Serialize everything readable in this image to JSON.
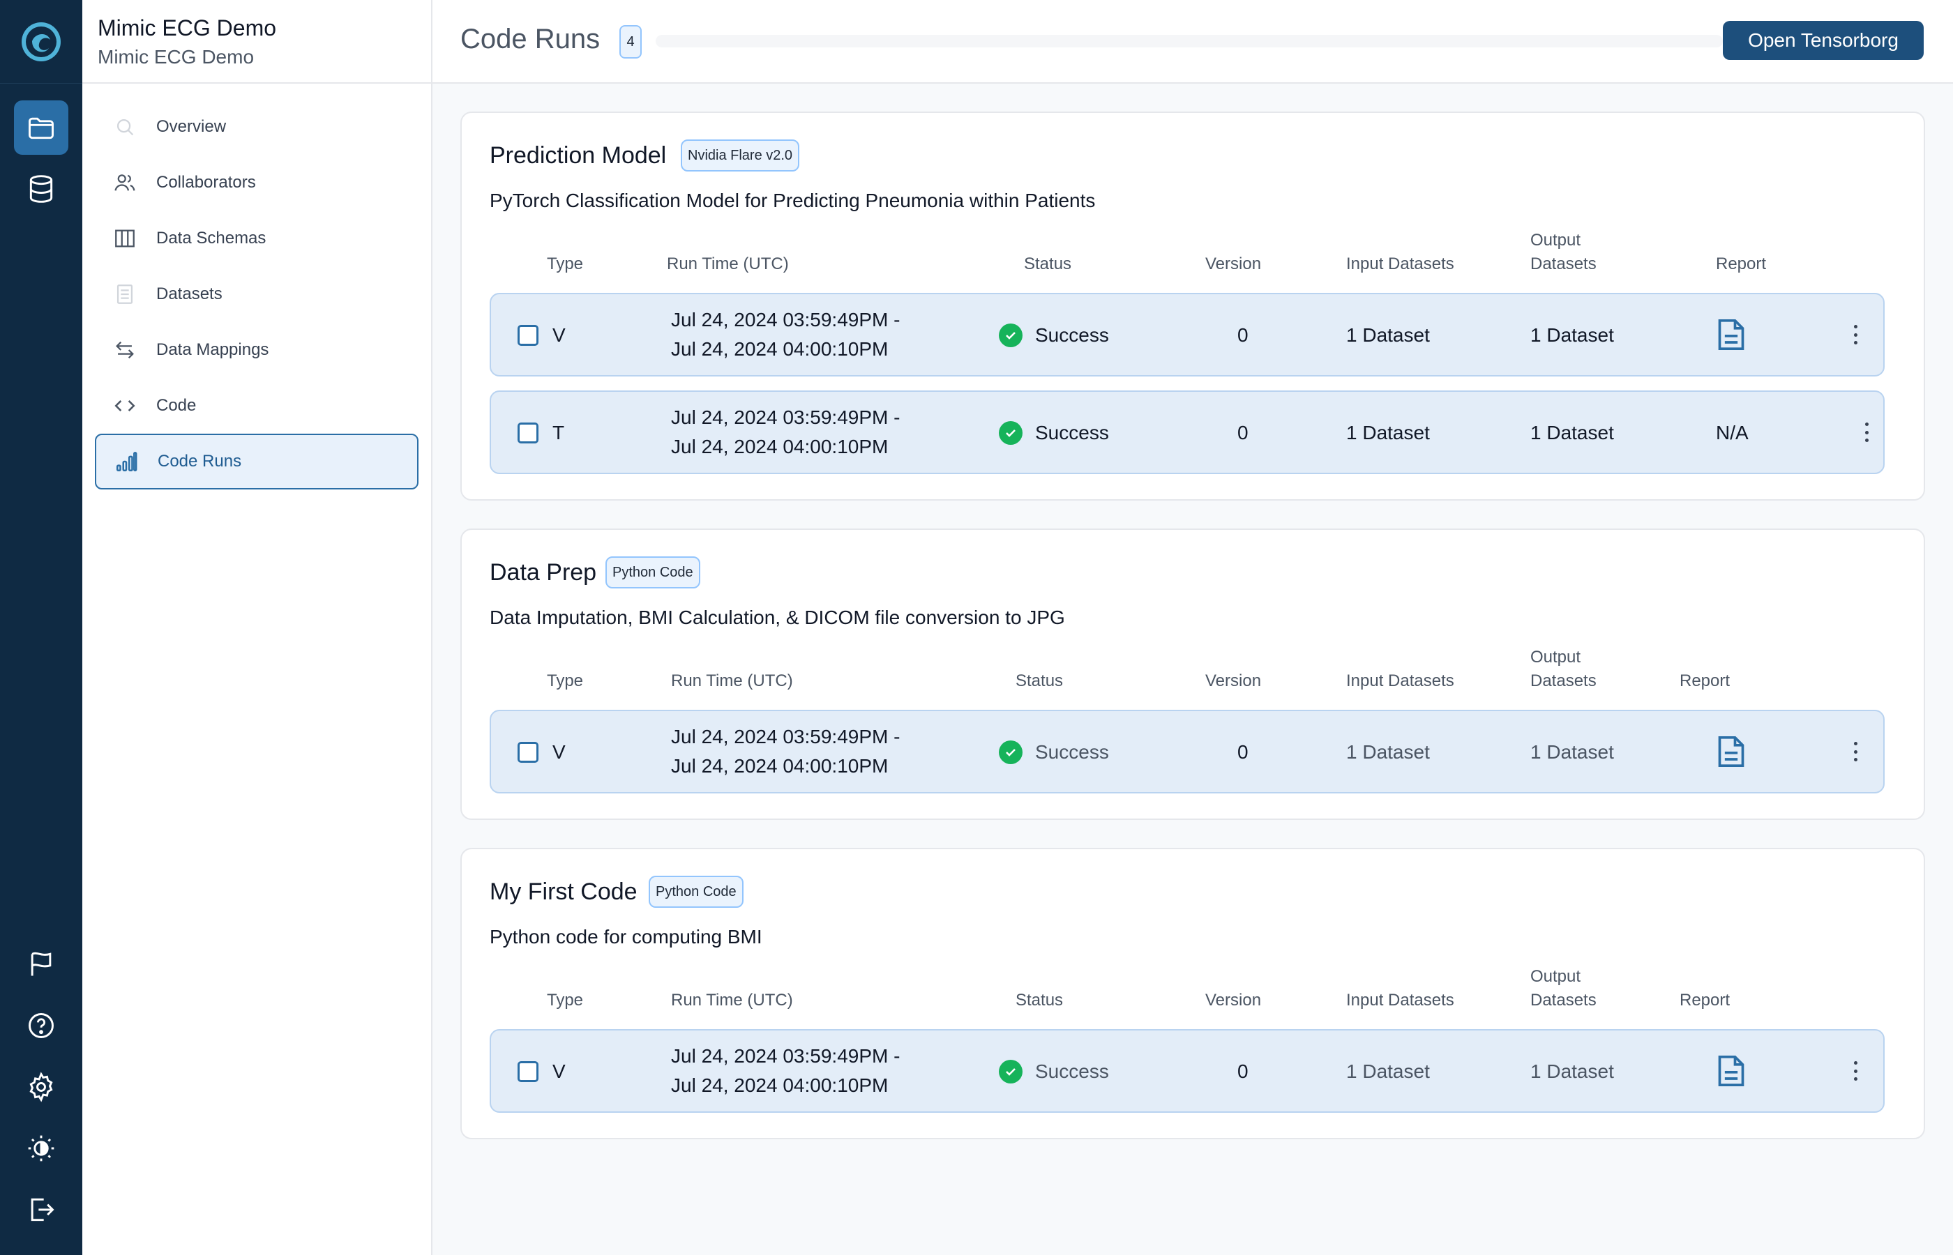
{
  "project": {
    "title": "Mimic ECG Demo",
    "subtitle": "Mimic ECG Demo"
  },
  "rail": {
    "top": [
      {
        "icon": "folder-icon",
        "active": true
      },
      {
        "icon": "database-icon",
        "active": false
      }
    ],
    "bottom": [
      {
        "icon": "flag-icon"
      },
      {
        "icon": "help-icon"
      },
      {
        "icon": "gear-icon"
      },
      {
        "icon": "theme-toggle-icon"
      },
      {
        "icon": "logout-icon"
      }
    ]
  },
  "nav": [
    {
      "label": "Overview",
      "icon": "search-icon"
    },
    {
      "label": "Collaborators",
      "icon": "users-icon"
    },
    {
      "label": "Data Schemas",
      "icon": "columns-icon"
    },
    {
      "label": "Datasets",
      "icon": "document-icon"
    },
    {
      "label": "Data Mappings",
      "icon": "arrows-swap-icon"
    },
    {
      "label": "Code",
      "icon": "code-icon"
    },
    {
      "label": "Code Runs",
      "icon": "bar-chart-icon",
      "active": true
    }
  ],
  "header": {
    "title": "Code Runs",
    "count": "4",
    "open_button": "Open Tensorborg"
  },
  "columns": {
    "type": "Type",
    "run_time": "Run Time (UTC)",
    "status": "Status",
    "version": "Version",
    "input": "Input Datasets",
    "output_line1": "Output",
    "output_line2": "Datasets",
    "report": "Report"
  },
  "cards": [
    {
      "title": "Prediction Model",
      "tag": "Nvidia Flare v2.0",
      "description": "PyTorch Classification Model for Predicting Pneumonia within Patients",
      "rows": [
        {
          "type": "V",
          "time_start": "Jul 24, 2024 03:59:49PM -",
          "time_end": "Jul 24, 2024 04:00:10PM",
          "status": "Success",
          "version": "0",
          "input": "1 Dataset",
          "output": "1 Dataset",
          "report": "report-doc-icon"
        },
        {
          "type": "T",
          "time_start": "Jul 24, 2024 03:59:49PM -",
          "time_end": "Jul 24, 2024 04:00:10PM",
          "status": "Success",
          "version": "0",
          "input": "1 Dataset",
          "output": "1 Dataset",
          "report": "N/A"
        }
      ]
    },
    {
      "title": "Data Prep",
      "tag": "Python Code",
      "description": "Data Imputation, BMI Calculation, & DICOM file conversion to JPG",
      "rows": [
        {
          "type": "V",
          "time_start": "Jul 24, 2024 03:59:49PM -",
          "time_end": "Jul 24, 2024 04:00:10PM",
          "status": "Success",
          "version": "0",
          "input": "1 Dataset",
          "output": "1 Dataset",
          "report": "report-doc-icon"
        }
      ]
    },
    {
      "title": "My First Code",
      "tag": "Python Code",
      "description": "Python code for computing BMI",
      "rows": [
        {
          "type": "V",
          "time_start": "Jul 24, 2024 03:59:49PM -",
          "time_end": "Jul 24, 2024 04:00:10PM",
          "status": "Success",
          "version": "0",
          "input": "1 Dataset",
          "output": "1 Dataset",
          "report": "report-doc-icon"
        }
      ]
    }
  ],
  "colors": {
    "rail_bg": "#0f2a43",
    "accent": "#2a6ea6",
    "primary_button": "#1d4f7c",
    "success": "#16b35a",
    "row_bg": "#e3edf8"
  }
}
